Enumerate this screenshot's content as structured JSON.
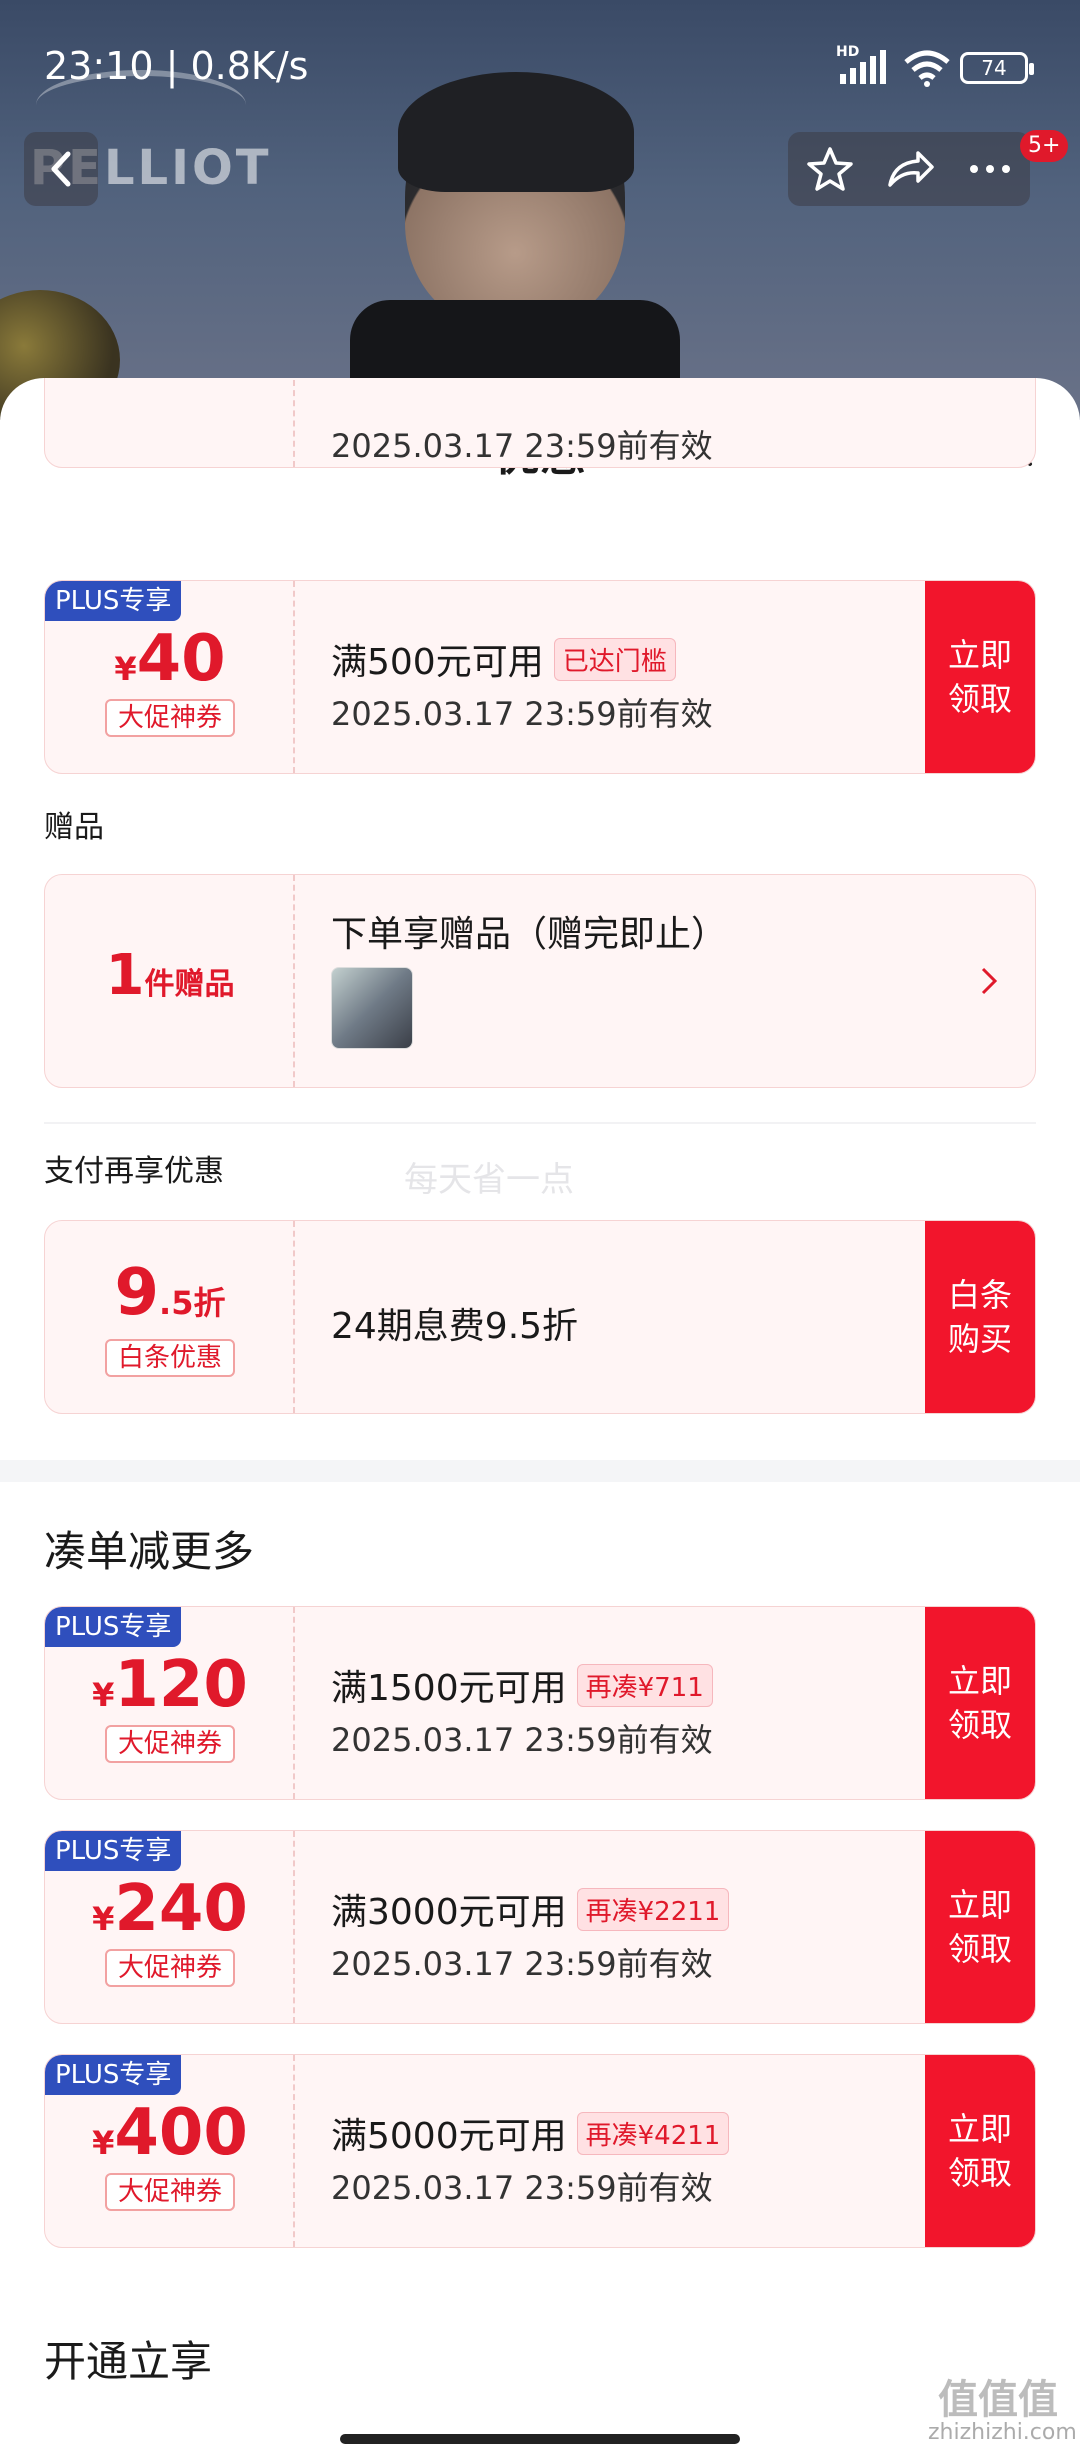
{
  "status": {
    "time": "23:10 | 0.8K/s",
    "hd": "HD",
    "battery": "74"
  },
  "header": {
    "brand_logo": "PELLIOT",
    "badge": "5+"
  },
  "sheet": {
    "title": "优惠",
    "partial_date": "2025.03.17 23:59前有效"
  },
  "coupons_top": [
    {
      "plus_tag": "PLUS专享",
      "yen": "¥",
      "amount": "40",
      "sub_tag": "大促神券",
      "desc": "满500元可用",
      "inline_tag": "已达门槛",
      "date": "2025.03.17 23:59前有效",
      "action": "立即\n领取"
    }
  ],
  "gift_section": {
    "label": "赠品",
    "count_num": "1",
    "count_unit": "件赠品",
    "title": "下单享赠品（赠完即止）"
  },
  "payment_section": {
    "label": "支付再享优惠",
    "amount_big": "9",
    "amount_small": ".5折",
    "sub_tag": "白条优惠",
    "desc": "24期息费9.5折",
    "action": "白条\n购买"
  },
  "watermark_mid": "每天省一点",
  "bundle_section": {
    "heading": "凑单减更多",
    "coupons": [
      {
        "plus_tag": "PLUS专享",
        "yen": "¥",
        "amount": "120",
        "sub_tag": "大促神券",
        "desc": "满1500元可用",
        "inline_tag": "再凑¥711",
        "date": "2025.03.17 23:59前有效",
        "action": "立即\n领取"
      },
      {
        "plus_tag": "PLUS专享",
        "yen": "¥",
        "amount": "240",
        "sub_tag": "大促神券",
        "desc": "满3000元可用",
        "inline_tag": "再凑¥2211",
        "date": "2025.03.17 23:59前有效",
        "action": "立即\n领取"
      },
      {
        "plus_tag": "PLUS专享",
        "yen": "¥",
        "amount": "400",
        "sub_tag": "大促神券",
        "desc": "满5000元可用",
        "inline_tag": "再凑¥4211",
        "date": "2025.03.17 23:59前有效",
        "action": "立即\n领取"
      }
    ]
  },
  "open_section": {
    "heading": "开通立享"
  },
  "corner_watermark": {
    "big": "值值值",
    "small": "zhizhizhi.com"
  },
  "colors": {
    "accent_red": "#f2152c",
    "plus_blue": "#2f4fbd",
    "coupon_bg": "#fff5f5"
  }
}
